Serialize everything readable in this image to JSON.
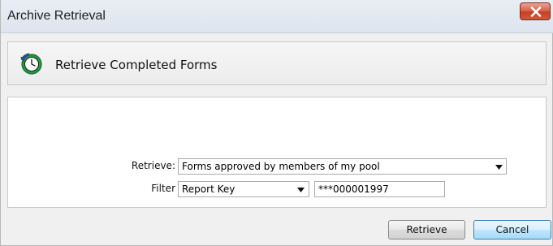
{
  "window": {
    "title": "Archive Retrieval",
    "close_icon": "close-icon"
  },
  "header": {
    "icon": "retrieve-archive-icon",
    "title": "Retrieve Completed Forms"
  },
  "form": {
    "retrieve_label": "Retrieve:",
    "retrieve_value": "Forms approved by members of my pool",
    "filter_label": "Filter",
    "filter_value": "Report Key",
    "filter_text": "***000001997"
  },
  "buttons": {
    "retrieve": "Retrieve",
    "cancel": "Cancel"
  },
  "colors": {
    "close_button": "#c64125",
    "default_button_border": "#3c7fb1"
  }
}
